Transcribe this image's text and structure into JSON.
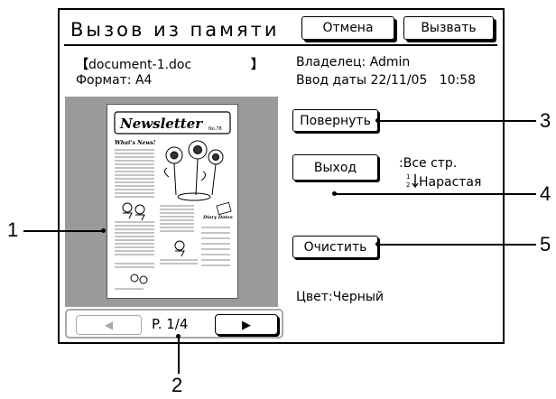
{
  "screen": {
    "title": "Вызов из памяти",
    "cancel_label": "Отмена",
    "recall_label": "Вызвать"
  },
  "document": {
    "name": "document-1.doc",
    "format_line": "Формат: A4",
    "owner_line": "Владелец: Admin",
    "date_label": "Ввод даты",
    "date": "22/11/05",
    "time": "10:58",
    "color_line": "Цвет:Черный"
  },
  "preview": {
    "newsletter_title": "Newsletter",
    "issue": "No.78",
    "section1": "What's News!",
    "section2": "Diary Dates"
  },
  "actions": {
    "rotate_label": "Повернуть",
    "exit_label": "Выход",
    "exit_pages": ":Все стр.",
    "exit_order": "Нарастая",
    "clear_label": "Очистить"
  },
  "pager": {
    "page_label": "P. 1/4",
    "prev_icon": "triangle-left-icon",
    "next_icon": "triangle-right-icon"
  },
  "callouts": {
    "c1": "1",
    "c2": "2",
    "c3": "3",
    "c4": "4",
    "c5": "5"
  }
}
